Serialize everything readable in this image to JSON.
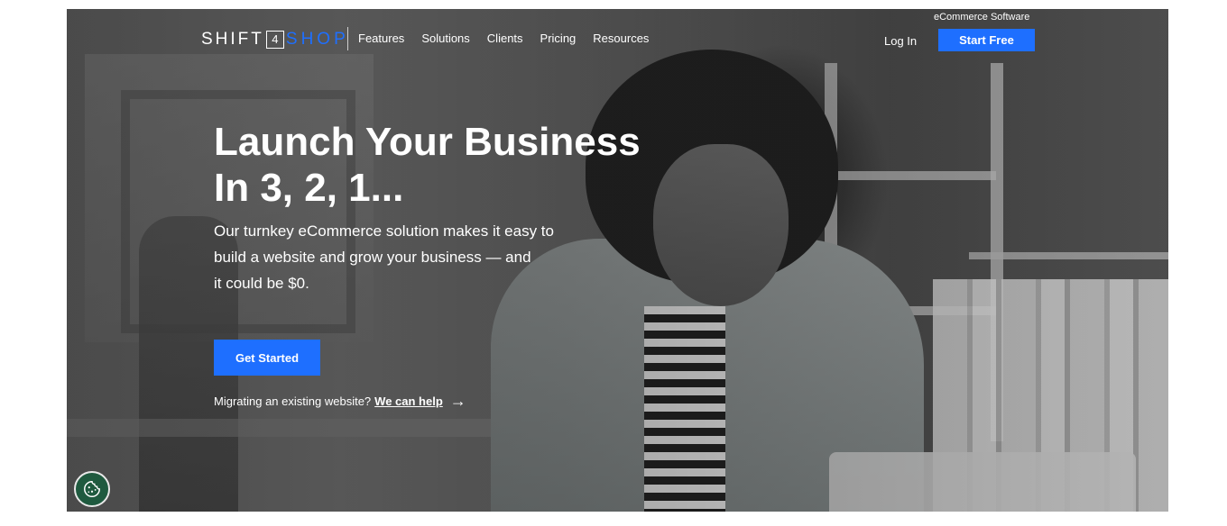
{
  "header": {
    "logo": {
      "part1": "SHIFT",
      "part2": "4",
      "part3": "SHOP"
    },
    "tagline": "eCommerce Software",
    "nav_items": [
      "Features",
      "Solutions",
      "Clients",
      "Pricing",
      "Resources"
    ],
    "login_label": "Log In",
    "start_free_label": "Start Free"
  },
  "hero": {
    "headline_line1": "Launch Your Business",
    "headline_line2": "In 3, 2, 1...",
    "subtext_line1": "Our turnkey eCommerce solution makes it easy to",
    "subtext_line2": "build a website and grow your business — and",
    "subtext_line3": "it could be $0.",
    "cta_label": "Get Started",
    "migrate_text": "Migrating an existing website?",
    "migrate_link": "We can help",
    "arrow_glyph": "→"
  },
  "icons": {
    "cookie": "cookie-icon",
    "arrow": "arrow-right-icon"
  },
  "colors": {
    "accent": "#1e6fff",
    "cookie_bg": "#1f5a3f"
  }
}
